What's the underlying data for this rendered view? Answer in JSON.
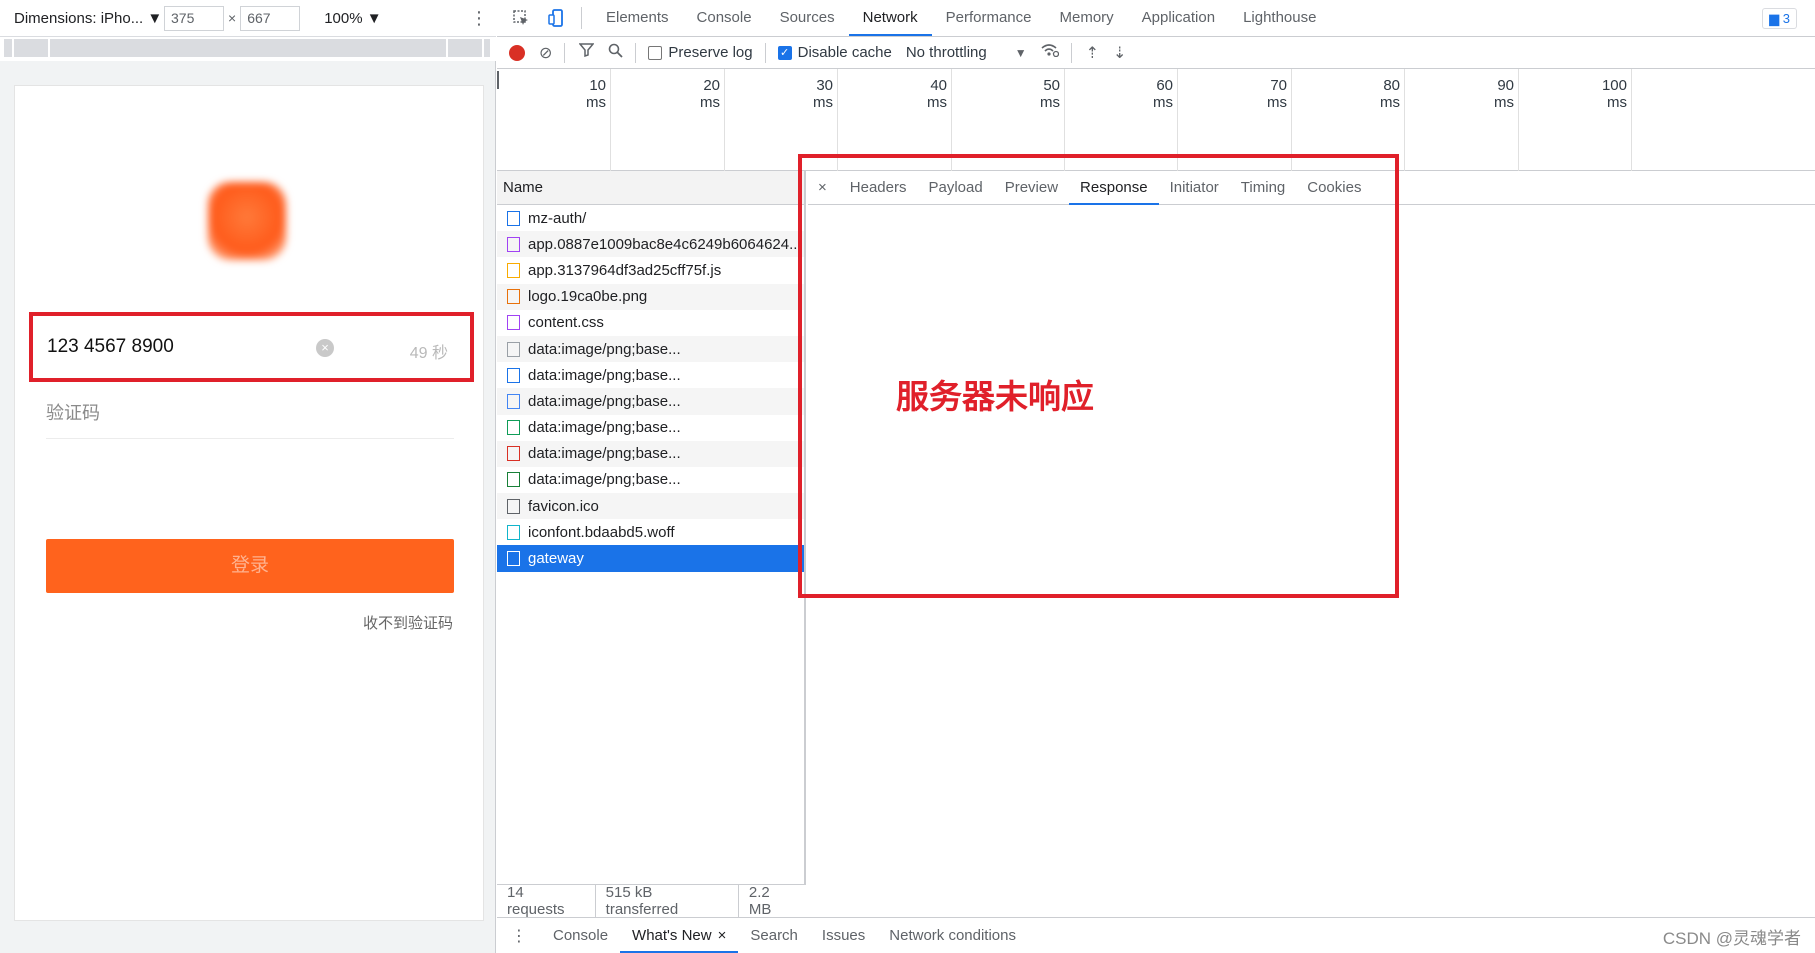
{
  "device_toolbar": {
    "dimensions_label": "Dimensions: iPho...",
    "width": "375",
    "height": "667",
    "times": "×",
    "zoom": "100%"
  },
  "phone_app": {
    "phone_number": "123 4567 8900",
    "countdown": "49 秒",
    "code_placeholder": "验证码",
    "login_label": "登录",
    "no_code_link": "收不到验证码"
  },
  "devtools": {
    "tabs": [
      "Elements",
      "Console",
      "Sources",
      "Network",
      "Performance",
      "Memory",
      "Application",
      "Lighthouse"
    ],
    "active_tab": "Network",
    "issues_count": "3",
    "network_toolbar": {
      "preserve_log": "Preserve log",
      "disable_cache": "Disable cache",
      "throttling": "No throttling"
    },
    "overview_ticks": [
      "10 ms",
      "20 ms",
      "30 ms",
      "40 ms",
      "50 ms",
      "60 ms",
      "70 ms",
      "80 ms",
      "90 ms",
      "100 ms"
    ],
    "requests_header": "Name",
    "requests": [
      {
        "name": "mz-auth/",
        "icon": "document-icon",
        "color": "#1a73e8"
      },
      {
        "name": "app.0887e1009bac8e4c6249b6064624...",
        "icon": "stylesheet-icon",
        "color": "#a142f4"
      },
      {
        "name": "app.3137964df3ad25cff75f.js",
        "icon": "script-icon",
        "color": "#f9ab00"
      },
      {
        "name": "logo.19ca0be.png",
        "icon": "image-icon",
        "color": "#e8710a"
      },
      {
        "name": "content.css",
        "icon": "stylesheet-icon",
        "color": "#a142f4"
      },
      {
        "name": "data:image/png;base...",
        "icon": "image-icon",
        "color": "#9aa0a6"
      },
      {
        "name": "data:image/png;base...",
        "icon": "image-icon",
        "color": "#1a73e8"
      },
      {
        "name": "data:image/png;base...",
        "icon": "image-icon",
        "color": "#4285f4"
      },
      {
        "name": "data:image/png;base...",
        "icon": "image-icon",
        "color": "#0f9d58"
      },
      {
        "name": "data:image/png;base...",
        "icon": "image-icon",
        "color": "#d93025"
      },
      {
        "name": "data:image/png;base...",
        "icon": "image-icon",
        "color": "#188038"
      },
      {
        "name": "favicon.ico",
        "icon": "file-icon",
        "color": "#5f6368"
      },
      {
        "name": "iconfont.bdaabd5.woff",
        "icon": "font-icon",
        "color": "#12b5cb"
      },
      {
        "name": "gateway",
        "icon": "file-icon",
        "color": "#ffffff"
      }
    ],
    "selected_request": "gateway",
    "status": {
      "requests": "14 requests",
      "transferred": "515 kB transferred",
      "resources": "2.2 MB"
    },
    "detail_close": "×",
    "detail_tabs": [
      "Headers",
      "Payload",
      "Preview",
      "Response",
      "Initiator",
      "Timing",
      "Cookies"
    ],
    "active_detail_tab": "Response",
    "response_message": "服务器未响应",
    "drawer_tabs": [
      "Console",
      "What's New",
      "Search",
      "Issues",
      "Network conditions"
    ],
    "active_drawer_tab": "What's New",
    "watermark": "CSDN @灵魂学者"
  },
  "colors": {
    "accent": "#1a73e8",
    "highlight": "#e0202a",
    "login_button": "#ff631d"
  }
}
